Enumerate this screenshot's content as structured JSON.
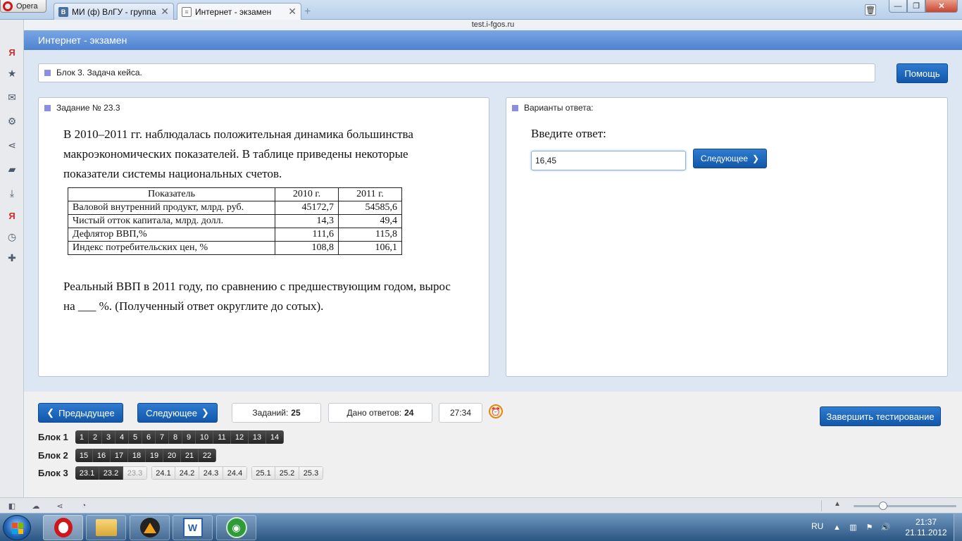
{
  "browser": {
    "menu_label": "Opera",
    "tabs": [
      {
        "favicon": "В",
        "title": "МИ (ф) ВлГУ - группа ..."
      },
      {
        "favicon": "",
        "title": "Интернет - экзамен"
      }
    ],
    "address": "test.i-fgos.ru"
  },
  "page": {
    "header_title": "Интернет - экзамен",
    "block_title": "Блок 3. Задача кейса.",
    "help_button": "Помощь",
    "task": {
      "heading": "Задание № 23.3",
      "intro": "В 2010–2011 гг. наблюдалась положительная динамика большинства макроэкономических показателей. В таблице приведены некоторые показатели системы национальных счетов.",
      "table": {
        "headers": [
          "Показатель",
          "2010 г.",
          "2011 г."
        ],
        "rows": [
          [
            "Валовой внутренний продукт, млрд. руб.",
            "45172,7",
            "54585,6"
          ],
          [
            "Чистый отток капитала, млрд. долл.",
            "14,3",
            "49,4"
          ],
          [
            "Дефлятор ВВП,%",
            "111,6",
            "115,8"
          ],
          [
            "Индекс потребительских цен, %",
            "108,8",
            "106,1"
          ]
        ]
      },
      "question": "Реальный ВВП в 2011 году, по сравнению с предшествующим годом, вырос на ___ %. (Полученный ответ округлите до сотых)."
    },
    "answers": {
      "heading": "Варианты ответа:",
      "prompt": "Введите ответ:",
      "input_value": "16,45",
      "next_button": "Следующее"
    }
  },
  "navigation": {
    "prev_button": "Предыдущее",
    "next_button": "Следующее",
    "tasks_label": "Заданий:",
    "tasks_count": "25",
    "answered_label": "Дано ответов:",
    "answered_count": "24",
    "timer": "27:34",
    "finish_button": "Завершить тестирование",
    "blocks": [
      {
        "label": "Блок 1",
        "items": [
          "1",
          "2",
          "3",
          "4",
          "5",
          "6",
          "7",
          "8",
          "9",
          "10",
          "11",
          "12",
          "13",
          "14"
        ]
      },
      {
        "label": "Блок 2",
        "items": [
          "15",
          "16",
          "17",
          "18",
          "19",
          "20",
          "21",
          "22"
        ]
      },
      {
        "label": "Блок 3",
        "groups": [
          [
            "23.1",
            "23.2",
            "23.3"
          ],
          [
            "24.1",
            "24.2",
            "24.3",
            "24.4"
          ],
          [
            "25.1",
            "25.2",
            "25.3"
          ]
        ],
        "answered": [
          "23.1",
          "23.2"
        ],
        "current": "23.3"
      }
    ]
  },
  "taskbar": {
    "language": "RU",
    "time": "21:37",
    "date": "21.11.2012"
  },
  "colors": {
    "header_blue": "#4f82d0",
    "button_blue": "#1257aa",
    "square_marker": "#8c8ee0",
    "answered_cell": "#262626"
  },
  "icons": {
    "sidebar": [
      "yandex-icon",
      "star-icon",
      "mail-icon",
      "gear-icon",
      "share-icon",
      "notes-icon",
      "download-icon",
      "yandex-bar-icon",
      "history-icon",
      "add-panel-icon"
    ]
  }
}
